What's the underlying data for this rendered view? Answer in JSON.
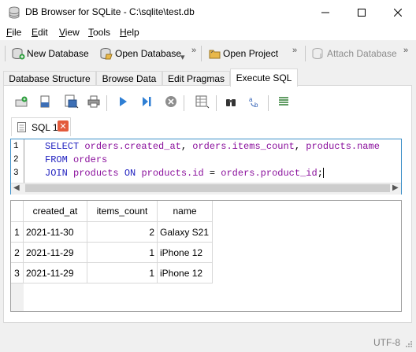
{
  "window": {
    "title": "DB Browser for SQLite - C:\\sqlite\\test.db"
  },
  "menu": [
    {
      "label": "File",
      "key": "F",
      "rest": "ile"
    },
    {
      "label": "Edit",
      "key": "E",
      "rest": "dit"
    },
    {
      "label": "View",
      "key": "V",
      "rest": "iew"
    },
    {
      "label": "Tools",
      "key": "T",
      "rest": "ools"
    },
    {
      "label": "Help",
      "key": "H",
      "rest": "elp"
    }
  ],
  "toolbar": {
    "new_database": "New Database",
    "open_database": "Open Database",
    "open_project": "Open Project",
    "attach_database": "Attach Database"
  },
  "tabs": [
    {
      "label": "Database Structure"
    },
    {
      "label": "Browse Data"
    },
    {
      "label": "Edit Pragmas"
    },
    {
      "label": "Execute SQL"
    }
  ],
  "sql_tab": {
    "label": "SQL 1",
    "close": "✕"
  },
  "editor": {
    "line_numbers": [
      "1",
      "2",
      "3"
    ],
    "lines": [
      [
        "SELECT",
        "orders.created_at",
        ",",
        "orders.items_count",
        ",",
        "products.name"
      ],
      [
        "FROM",
        "orders"
      ],
      [
        "JOIN",
        "products",
        "ON",
        "products.id",
        "=",
        "orders.product_id",
        ";"
      ]
    ]
  },
  "results": {
    "columns": [
      "created_at",
      "items_count",
      "name"
    ],
    "rows": [
      {
        "rownum": "1",
        "created_at": "2021-11-30",
        "items_count": "2",
        "name": "Galaxy S21"
      },
      {
        "rownum": "2",
        "created_at": "2021-11-29",
        "items_count": "1",
        "name": "iPhone 12"
      },
      {
        "rownum": "3",
        "created_at": "2021-11-29",
        "items_count": "1",
        "name": "iPhone 12"
      }
    ]
  },
  "status": {
    "encoding": "UTF-8"
  },
  "colors": {
    "editor_border": "#3c8fc8",
    "keyword": "#1f1fbf",
    "identifier": "#8a0f9c",
    "close_tab": "#e35b3c"
  }
}
